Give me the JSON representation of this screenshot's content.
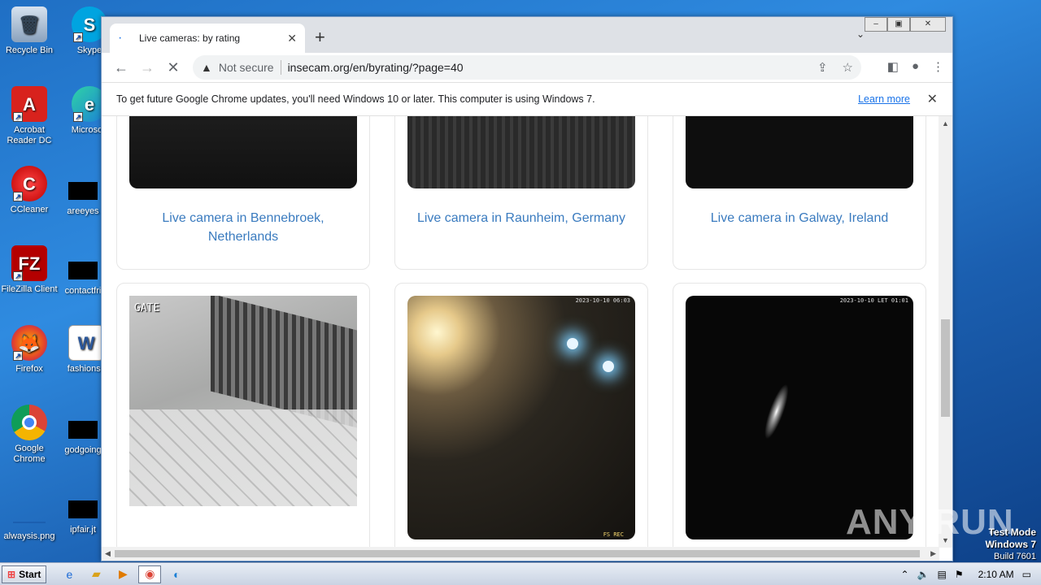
{
  "desktop": {
    "icons": [
      {
        "label": "Recycle Bin",
        "icon": "recycle-bin-icon"
      },
      {
        "label": "Skype",
        "icon": "skype-icon"
      },
      {
        "label": "Acrobat Reader DC",
        "icon": "acrobat-icon"
      },
      {
        "label": "Microsoft",
        "icon": "edge-icon"
      },
      {
        "label": "CCleaner",
        "icon": "ccleaner-icon"
      },
      {
        "label": "areeyes",
        "icon": "file-icon"
      },
      {
        "label": "FileZilla Client",
        "icon": "filezilla-icon"
      },
      {
        "label": "contactfri",
        "icon": "file-icon"
      },
      {
        "label": "Firefox",
        "icon": "firefox-icon"
      },
      {
        "label": "fashionsy",
        "icon": "word-icon"
      },
      {
        "label": "Google Chrome",
        "icon": "chrome-icon"
      },
      {
        "label": "godgoing",
        "icon": "file-icon"
      },
      {
        "label": "alwaysis.png",
        "icon": "image-icon"
      },
      {
        "label": "ipfair.jt",
        "icon": "file-icon"
      }
    ]
  },
  "browser": {
    "tab": {
      "title": "Live cameras: by rating",
      "favicon": "loading-dot"
    },
    "new_tab": "+",
    "address": {
      "security": "Not secure",
      "url": "insecam.org/en/byrating/?page=40"
    },
    "infobar": {
      "message": "To get future Google Chrome updates, you'll need Windows 10 or later. This computer is using Windows 7.",
      "link": "Learn more"
    }
  },
  "page": {
    "cards_row1": [
      {
        "label": "Live camera in Bennebroek, Netherlands"
      },
      {
        "label": "Live camera in Raunheim, Germany"
      },
      {
        "label": "Live camera in Galway, Ireland"
      }
    ],
    "cards_row2": [
      {
        "overlay": "GATE"
      },
      {
        "overlay_top": "2023-10-10 06:03",
        "overlay_bottom_right": "FS REC"
      },
      {
        "overlay_top": "2023-10-10 LET 01:01"
      }
    ]
  },
  "taskbar": {
    "start_label": "Start",
    "clock": "2:10 AM"
  },
  "watermark": {
    "brand": "ANY RUN",
    "line1": "Test Mode",
    "line2": "Windows 7",
    "line3": "Build 7601"
  }
}
